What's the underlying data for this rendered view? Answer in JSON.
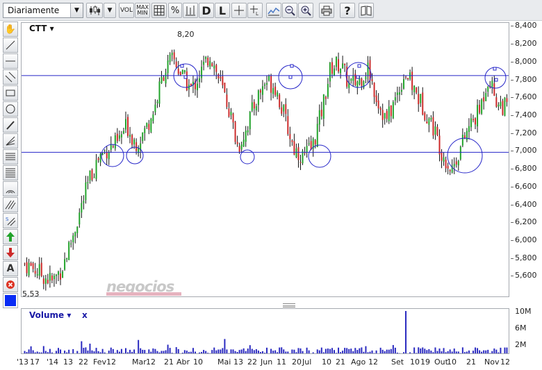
{
  "toolbar": {
    "period_select": "Diariamente",
    "vol_label": "VOL",
    "max_label": "MAX",
    "min_label": "MIN",
    "percent_label": "%",
    "d_label": "D",
    "l_label": "L",
    "help_label": "?"
  },
  "sidetools": {
    "text_tool_label": "A"
  },
  "colors": {
    "up": "#22a32b",
    "down": "#cc2a2a",
    "wick": "#111111",
    "annotation": "#2424c8",
    "volume": "#2a2ac0",
    "swatch": "#0a2cf5"
  },
  "chart_data": {
    "type": "candlestick",
    "ticker_label": "CTT ▾",
    "high_label": "8,20",
    "low_label": "5,53",
    "watermark": "negocios",
    "y_ticks": [
      "8,400",
      "8,200",
      "8,000",
      "7,800",
      "7,600",
      "7,400",
      "7,200",
      "7,000",
      "6,800",
      "6,600",
      "6,400",
      "6,200",
      "6,000",
      "5,800",
      "5,600"
    ],
    "y_values": [
      8.4,
      8.2,
      8.0,
      7.8,
      7.6,
      7.4,
      7.2,
      7.0,
      6.8,
      6.6,
      6.4,
      6.2,
      6.0,
      5.8,
      5.6
    ],
    "ylim": [
      5.37,
      8.45
    ],
    "x_ticks": [
      "'13",
      "17",
      "'14",
      "13",
      "22",
      "Fev",
      "12",
      "Mar",
      "12",
      "21",
      "Abr",
      "10",
      "Mai",
      "13",
      "22",
      "Jun",
      "11",
      "20",
      "Jul",
      "10",
      "21",
      "Ago",
      "12",
      "Set",
      "10",
      "19",
      "Out",
      "10",
      "21",
      "Nov",
      "12"
    ],
    "horizontal_lines": [
      7.86,
      7.0
    ],
    "price_path": [
      5.75,
      5.7,
      5.62,
      5.55,
      5.7,
      6.0,
      6.35,
      6.7,
      6.95,
      7.05,
      7.1,
      7.3,
      7.1,
      7.25,
      7.5,
      7.9,
      8.05,
      7.85,
      7.7,
      7.9,
      8.1,
      7.8,
      7.5,
      7.05,
      7.3,
      7.6,
      7.8,
      7.75,
      7.4,
      7.05,
      6.95,
      7.05,
      7.45,
      7.95,
      8.0,
      7.75,
      7.8,
      7.95,
      7.6,
      7.35,
      7.6,
      7.9,
      7.7,
      7.5,
      7.3,
      7.0,
      6.8,
      7.05,
      7.3,
      7.45,
      7.85,
      7.55,
      7.5
    ],
    "volume": {
      "title": "Volume ▾",
      "close": "x",
      "y_ticks": [
        "10M",
        "6M",
        "2M"
      ],
      "y_values": [
        10,
        6,
        2
      ],
      "ylim": [
        0,
        11
      ],
      "spike_value": 10.5
    }
  }
}
